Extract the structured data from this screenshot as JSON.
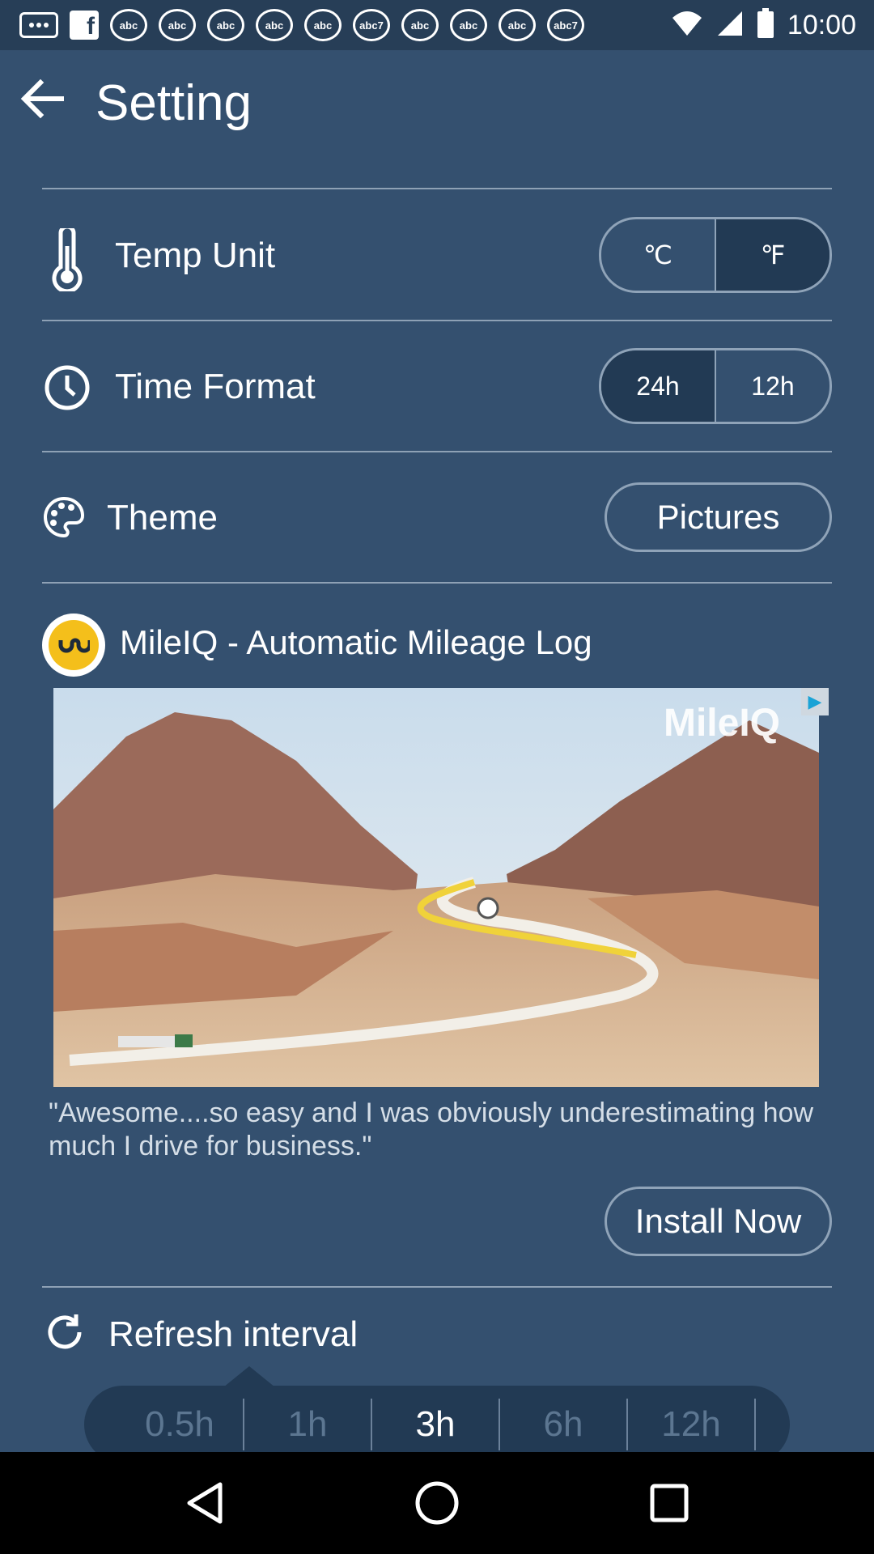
{
  "status_bar": {
    "time": "10:00",
    "notification_icons": [
      "message-icon",
      "facebook-icon",
      "abc-news-icon",
      "abc-news-icon",
      "abc-news-icon",
      "abc-news-icon",
      "abc-news-icon",
      "abc7-icon",
      "abc-news-icon",
      "abc-news-icon",
      "abc-news-icon",
      "abc7-icon"
    ],
    "icon_text": "abc",
    "icon_text_alt": "abc7"
  },
  "header": {
    "title": "Setting"
  },
  "settings": {
    "temp_unit": {
      "label": "Temp Unit",
      "options": [
        "℃",
        "℉"
      ],
      "selected": "℉"
    },
    "time_format": {
      "label": "Time Format",
      "options": [
        "24h",
        "12h"
      ],
      "selected": "24h"
    },
    "theme": {
      "label": "Theme",
      "value": "Pictures"
    }
  },
  "ad": {
    "title": "MileIQ - Automatic Mileage Log",
    "brand_overlay": "MileIQ",
    "quote": "\"Awesome....so easy and I was obviously underestimating how much I drive for business.\"",
    "cta": "Install Now"
  },
  "refresh": {
    "label": "Refresh interval",
    "options": [
      "0.5h",
      "1h",
      "3h",
      "6h",
      "12h"
    ],
    "selected": "3h"
  },
  "colors": {
    "background": "#34506f",
    "status_bar": "#273e57",
    "active_segment": "#223a54",
    "divider": "#8ea1b5"
  }
}
